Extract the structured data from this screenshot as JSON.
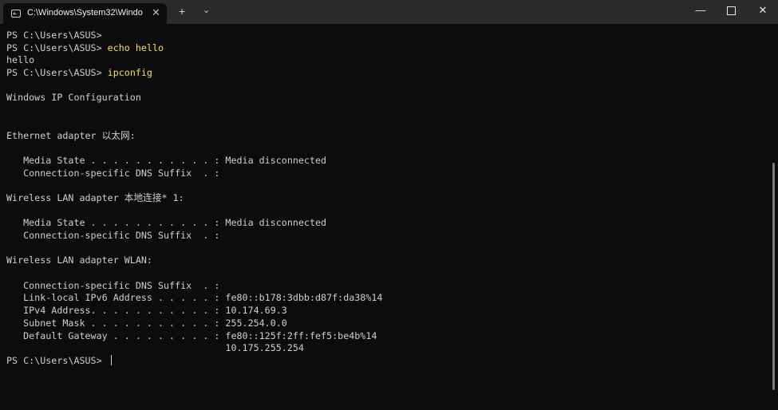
{
  "tab": {
    "title": "C:\\Windows\\System32\\Windo",
    "close_glyph": "✕",
    "new_tab_glyph": "+",
    "dropdown_glyph": "⌄"
  },
  "window_controls": {
    "minimize_glyph": "—",
    "close_glyph": "✕"
  },
  "terminal": {
    "lines": [
      {
        "prompt": "PS C:\\Users\\ASUS>",
        "command": ""
      },
      {
        "prompt": "PS C:\\Users\\ASUS> ",
        "command": "echo hello"
      },
      {
        "text": "hello"
      },
      {
        "prompt": "PS C:\\Users\\ASUS> ",
        "command": "ipconfig"
      },
      {
        "text": ""
      },
      {
        "text": "Windows IP Configuration"
      },
      {
        "text": ""
      },
      {
        "text": ""
      },
      {
        "text": "Ethernet adapter 以太网:"
      },
      {
        "text": ""
      },
      {
        "text": "   Media State . . . . . . . . . . . : Media disconnected"
      },
      {
        "text": "   Connection-specific DNS Suffix  . :"
      },
      {
        "text": ""
      },
      {
        "text": "Wireless LAN adapter 本地连接* 1:"
      },
      {
        "text": ""
      },
      {
        "text": "   Media State . . . . . . . . . . . : Media disconnected"
      },
      {
        "text": "   Connection-specific DNS Suffix  . :"
      },
      {
        "text": ""
      },
      {
        "text": "Wireless LAN adapter WLAN:"
      },
      {
        "text": ""
      },
      {
        "text": "   Connection-specific DNS Suffix  . :"
      },
      {
        "text": "   Link-local IPv6 Address . . . . . : fe80::b178:3dbb:d87f:da38%14"
      },
      {
        "text": "   IPv4 Address. . . . . . . . . . . : 10.174.69.3"
      },
      {
        "text": "   Subnet Mask . . . . . . . . . . . : 255.254.0.0"
      },
      {
        "text": "   Default Gateway . . . . . . . . . : fe80::125f:2ff:fef5:be4b%14"
      },
      {
        "text": "                                       10.175.255.254"
      },
      {
        "prompt": "PS C:\\Users\\ASUS> ",
        "command": "",
        "cursor": true
      }
    ]
  },
  "colors": {
    "background": "#0c0c0c",
    "text": "#cfcfcf",
    "command": "#f1e05a",
    "titlebar": "#2b2b2b"
  }
}
